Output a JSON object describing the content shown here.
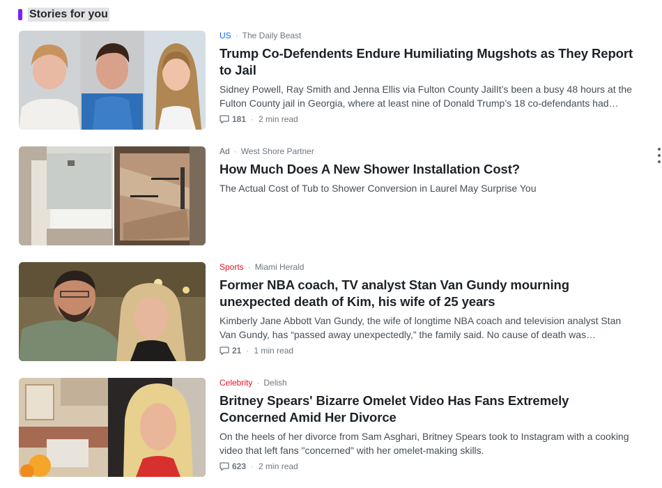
{
  "section": {
    "title": "Stories for you",
    "accent_color": "#7e1fff"
  },
  "stories": [
    {
      "category": "US",
      "category_color": "#0f69ff",
      "source": "The Daily Beast",
      "headline": "Trump Co-Defendents Endure Humiliating Mugshots as They Report to Jail",
      "summary": "Sidney Powell, Ray Smith and Jenna Ellis via Fulton County JailIt’s been a busy 48 hours at the Fulton County jail in Georgia, where at least nine of Donald Trump’s 18 co-defendants had…",
      "comments": "181",
      "read_time": "2 min read",
      "image": "three-mugshots"
    },
    {
      "category": "Ad",
      "category_color": "#5b636a",
      "source": "West Shore Partner",
      "headline": "How Much Does A New Shower Installation Cost?",
      "summary": "The Actual Cost of Tub to Shower Conversion in Laurel May Surprise You",
      "image": "shower-before-after"
    },
    {
      "category": "Sports",
      "category_color": "#eb0f29",
      "source": "Miami Herald",
      "headline": "Former NBA coach, TV analyst Stan Van Gundy mourning unexpected death of Kim, his wife of 25 years",
      "summary": "Kimberly Jane Abbott Van Gundy, the wife of longtime NBA coach and television analyst Stan Van Gundy, has “passed away unexpectedly,” the family said. No cause of death was…",
      "comments": "21",
      "read_time": "1 min read",
      "image": "couple-photo"
    },
    {
      "category": "Celebrity",
      "category_color": "#eb0f29",
      "source": "Delish",
      "headline": "Britney Spears' Bizarre Omelet Video Has Fans Extremely Concerned Amid Her Divorce",
      "summary": "On the heels of her divorce from Sam Asghari, Britney Spears took to Instagram with a cooking video that left fans \"concerned\" with her omelet-making skills.",
      "comments": "623",
      "read_time": "2 min read",
      "image": "kitchen-and-portrait"
    }
  ]
}
